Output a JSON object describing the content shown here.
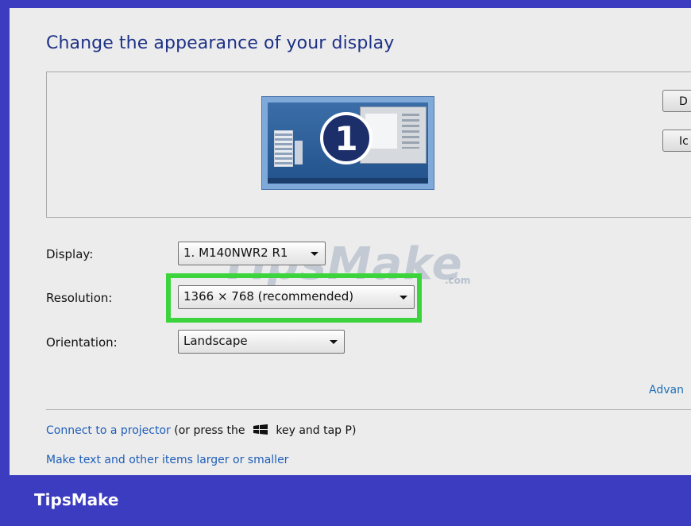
{
  "page": {
    "title": "Change the appearance of your display"
  },
  "preview": {
    "monitor_number": "1",
    "side_buttons": [
      "D",
      "Ic"
    ]
  },
  "settings": {
    "display_label": "Display:",
    "display_value": "1. M140NWR2 R1",
    "resolution_label": "Resolution:",
    "resolution_value": "1366 × 768 (recommended)",
    "orientation_label": "Orientation:",
    "orientation_value": "Landscape"
  },
  "links": {
    "advanced": "Advan",
    "projector_link": "Connect to a projector",
    "projector_suffix_1": " (or press the ",
    "projector_suffix_2": " key and tap P)",
    "text_size": "Make text and other items larger or smaller"
  },
  "watermark": {
    "text": "TipsMake",
    "domain": ".com"
  },
  "footer": {
    "brand": "TipsMake"
  },
  "colors": {
    "frame": "#3c3cc0",
    "highlight": "#3cd43c",
    "title": "#1e3287",
    "link": "#1e5eb8"
  }
}
